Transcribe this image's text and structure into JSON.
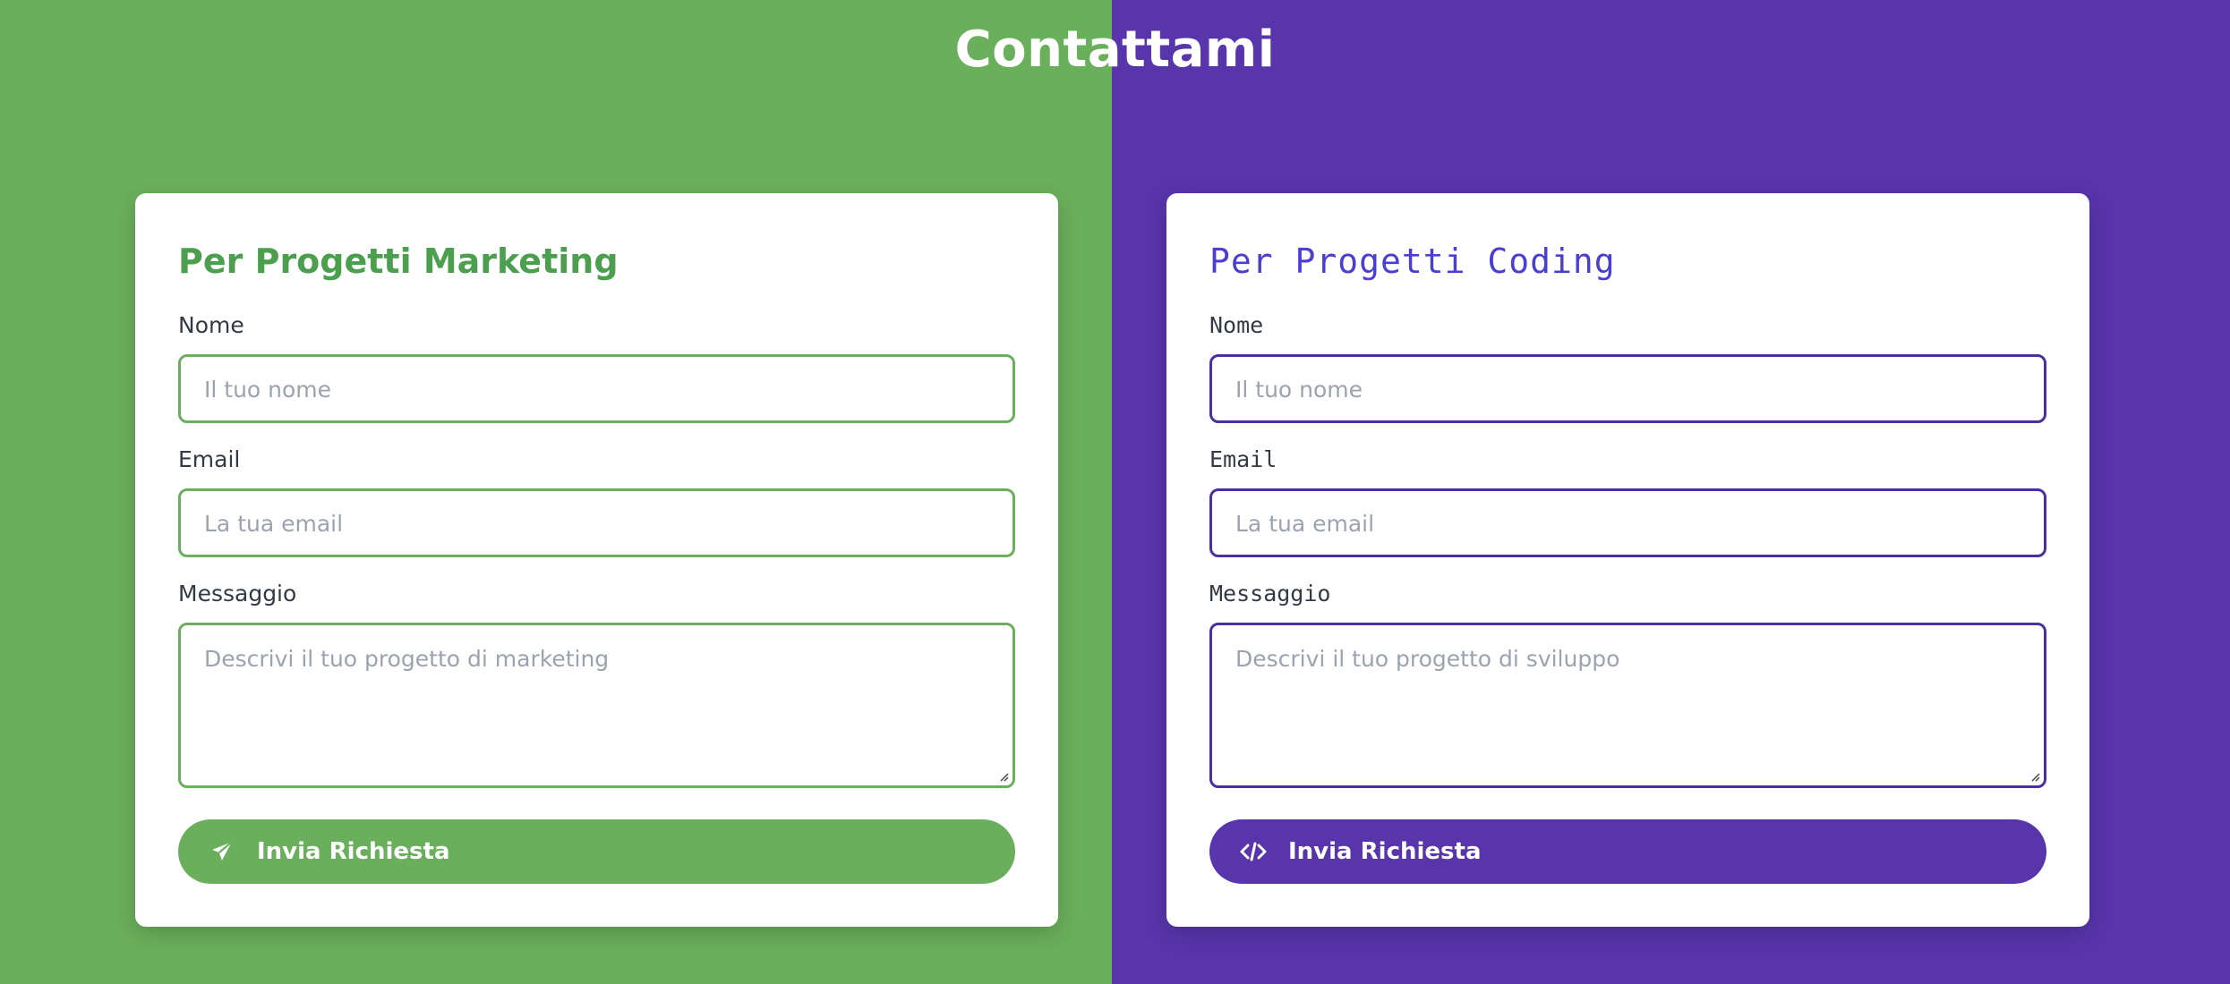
{
  "page": {
    "title": "Contattami"
  },
  "colors": {
    "marketing_accent": "#6aaf5c",
    "marketing_title": "#4c9f4e",
    "coding_accent": "#5835ab",
    "coding_title": "#4a3fd1"
  },
  "marketing": {
    "title": "Per Progetti Marketing",
    "name_label": "Nome",
    "name_placeholder": "Il tuo nome",
    "email_label": "Email",
    "email_placeholder": "La tua email",
    "message_label": "Messaggio",
    "message_placeholder": "Descrivi il tuo progetto di marketing",
    "submit_label": "Invia Richiesta",
    "submit_icon": "paper-plane-icon"
  },
  "coding": {
    "title": "Per Progetti Coding",
    "name_label": "Nome",
    "name_placeholder": "Il tuo nome",
    "email_label": "Email",
    "email_placeholder": "La tua email",
    "message_label": "Messaggio",
    "message_placeholder": "Descrivi il tuo progetto di sviluppo",
    "submit_label": "Invia Richiesta",
    "submit_icon": "code-icon"
  }
}
